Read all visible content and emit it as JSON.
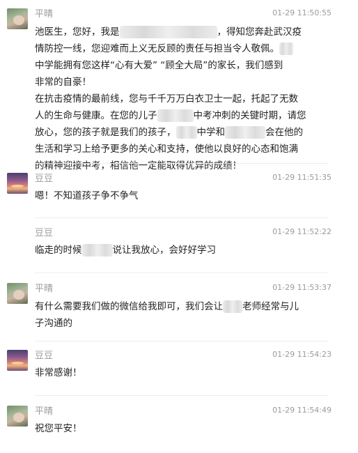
{
  "messages": [
    {
      "sender": "平晴",
      "time": "01-29 11:50:55",
      "avatar": "person-photo",
      "lines": [
        {
          "a": "池医生，您好，我是",
          "b": "，得知您奔赴武汉疫"
        },
        {
          "a": "情防控一线，您迎难而上义无反顾的责任与担当令人敬佩。"
        },
        {
          "a": "中学能拥有您这样“心有大爱” “顾全大局”的家长，我们感到"
        },
        {
          "a": "非常的自豪！"
        },
        {
          "a": "在抗击疫情的最前线，您与千千万万白衣卫士一起，托起了无数"
        },
        {
          "a": "人的生命与健康。在您的儿子",
          "b": "中考冲刺的关键时期，请您"
        },
        {
          "a": "放心，您的孩子就是我们的孩子，",
          "b": "中学和",
          "c": "会在他的"
        },
        {
          "a": "生活和学习上给予更多的关心和支持，使他以良好的心态和饱满"
        },
        {
          "a": "的精神迎接中考，相信他一定能取得优异的成绩！"
        }
      ]
    },
    {
      "sender": "豆豆",
      "time": "01-29 11:51:35",
      "avatar": "sunset-photo",
      "text": "嗯！不知道孩子争不争气"
    },
    {
      "sender": "豆豆",
      "time": "01-29 11:52:22",
      "avatar": "none",
      "text_a": "临走的时候",
      "text_b": "说让我放心，会好好学习"
    },
    {
      "sender": "平晴",
      "time": "01-29 11:53:37",
      "avatar": "person-photo",
      "line1_a": "有什么需要我们做的微信给我即可，我们会让",
      "line1_b": "老师经常与儿",
      "line2": "子沟通的"
    },
    {
      "sender": "豆豆",
      "time": "01-29 11:54:23",
      "avatar": "sunset-photo",
      "text": "非常感谢！"
    },
    {
      "sender": "平晴",
      "time": "01-29 11:54:49",
      "avatar": "person-photo",
      "text": "祝您平安！"
    }
  ]
}
